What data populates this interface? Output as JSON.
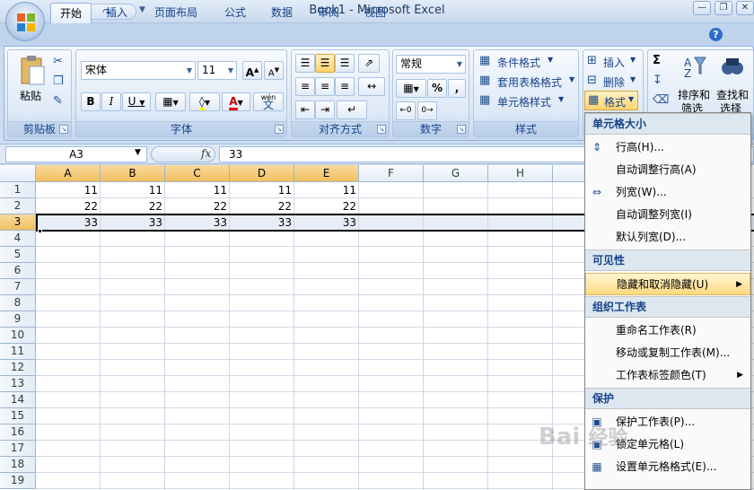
{
  "window": {
    "title": "Book1 - Microsoft Excel"
  },
  "tabs": [
    "开始",
    "插入",
    "页面布局",
    "公式",
    "数据",
    "审阅",
    "视图"
  ],
  "ribbon": {
    "clipboard": {
      "paste_label": "粘贴",
      "group_label": "剪贴板"
    },
    "font": {
      "font_name": "宋体",
      "font_size": "11",
      "group_label": "字体",
      "bold": "B",
      "italic": "I",
      "underline": "U",
      "grow": "A",
      "shrink": "A",
      "font_color": "A",
      "phonetic": "wén",
      "phonetic_char": "文"
    },
    "alignment": {
      "group_label": "对齐方式"
    },
    "number": {
      "format": "常规",
      "group_label": "数字",
      "percent": "%",
      "comma": ","
    },
    "styles": {
      "conditional": "条件格式",
      "table": "套用表格格式",
      "cell": "单元格样式",
      "group_label": "样式"
    },
    "cells": {
      "insert": "插入",
      "delete": "删除",
      "format": "格式"
    },
    "editing": {
      "sort": "排序和",
      "sort2": "筛选",
      "find": "查找和",
      "find2": "选择"
    }
  },
  "formula_bar": {
    "name_box": "A3",
    "fx": "fx",
    "value": "33"
  },
  "grid": {
    "columns": [
      "A",
      "B",
      "C",
      "D",
      "E",
      "F",
      "G",
      "H",
      "I"
    ],
    "rows": [
      "1",
      "2",
      "3",
      "4",
      "5",
      "6",
      "7",
      "8",
      "9",
      "10",
      "11",
      "12",
      "13",
      "14",
      "15",
      "16",
      "17",
      "18",
      "19"
    ],
    "data": [
      [
        "11",
        "11",
        "11",
        "11",
        "11"
      ],
      [
        "22",
        "22",
        "22",
        "22",
        "22"
      ],
      [
        "33",
        "33",
        "33",
        "33",
        "33"
      ]
    ],
    "selected_row": "3"
  },
  "menu": {
    "sections": [
      {
        "header": "单元格大小",
        "items": [
          {
            "label": "行高(H)...",
            "icon": "row-height-icon"
          },
          {
            "label": "自动调整行高(A)"
          },
          {
            "label": "列宽(W)...",
            "icon": "column-width-icon"
          },
          {
            "label": "自动调整列宽(I)"
          },
          {
            "label": "默认列宽(D)..."
          }
        ]
      },
      {
        "header": "可见性",
        "items": [
          {
            "label": "隐藏和取消隐藏(U)",
            "submenu": true,
            "highlighted": true
          }
        ]
      },
      {
        "header": "组织工作表",
        "items": [
          {
            "label": "重命名工作表(R)"
          },
          {
            "label": "移动或复制工作表(M)..."
          },
          {
            "label": "工作表标签颜色(T)",
            "submenu": true
          }
        ]
      },
      {
        "header": "保护",
        "items": [
          {
            "label": "保护工作表(P)...",
            "icon": "protect-sheet-icon"
          },
          {
            "label": "锁定单元格(L)",
            "icon": "lock-icon"
          },
          {
            "label": "设置单元格格式(E)...",
            "icon": "format-cells-icon"
          }
        ]
      }
    ]
  },
  "watermark": "Bai 经验"
}
